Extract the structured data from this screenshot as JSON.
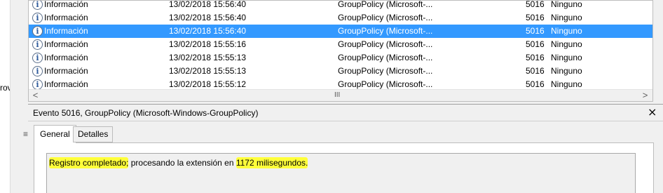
{
  "left_panel": {
    "cut_text": "rov",
    "grip": "≡"
  },
  "events": [
    {
      "level": "Información",
      "date": "13/02/2018 15:56:40",
      "source": "GroupPolicy (Microsoft-...",
      "id": "5016",
      "task": "Ninguno",
      "selected": false
    },
    {
      "level": "Información",
      "date": "13/02/2018 15:56:40",
      "source": "GroupPolicy (Microsoft-...",
      "id": "5016",
      "task": "Ninguno",
      "selected": false
    },
    {
      "level": "Información",
      "date": "13/02/2018 15:56:40",
      "source": "GroupPolicy (Microsoft-...",
      "id": "5016",
      "task": "Ninguno",
      "selected": true
    },
    {
      "level": "Información",
      "date": "13/02/2018 15:55:16",
      "source": "GroupPolicy (Microsoft-...",
      "id": "5016",
      "task": "Ninguno",
      "selected": false
    },
    {
      "level": "Información",
      "date": "13/02/2018 15:55:13",
      "source": "GroupPolicy (Microsoft-...",
      "id": "5016",
      "task": "Ninguno",
      "selected": false
    },
    {
      "level": "Información",
      "date": "13/02/2018 15:55:13",
      "source": "GroupPolicy (Microsoft-...",
      "id": "5016",
      "task": "Ninguno",
      "selected": false
    },
    {
      "level": "Información",
      "date": "13/02/2018 15:55:12",
      "source": "GroupPolicy (Microsoft-...",
      "id": "5016",
      "task": "Ninguno",
      "selected": false
    }
  ],
  "info_icon_glyph": "i",
  "hscroll": {
    "left_arrow": "<",
    "right_arrow": ">",
    "grip": "III"
  },
  "detail": {
    "title": "Evento 5016, GroupPolicy (Microsoft-Windows-GroupPolicy)",
    "close_glyph": "×",
    "tabs": [
      "General",
      "Detalles"
    ],
    "description": {
      "part1": "Registro completado;",
      "part2": " procesando la extensión en ",
      "part3": "1172 milisegundos."
    }
  },
  "colors": {
    "selection": "#3399ff",
    "highlight": "#ffff3a"
  },
  "icons": {
    "event_level": "info-icon"
  }
}
